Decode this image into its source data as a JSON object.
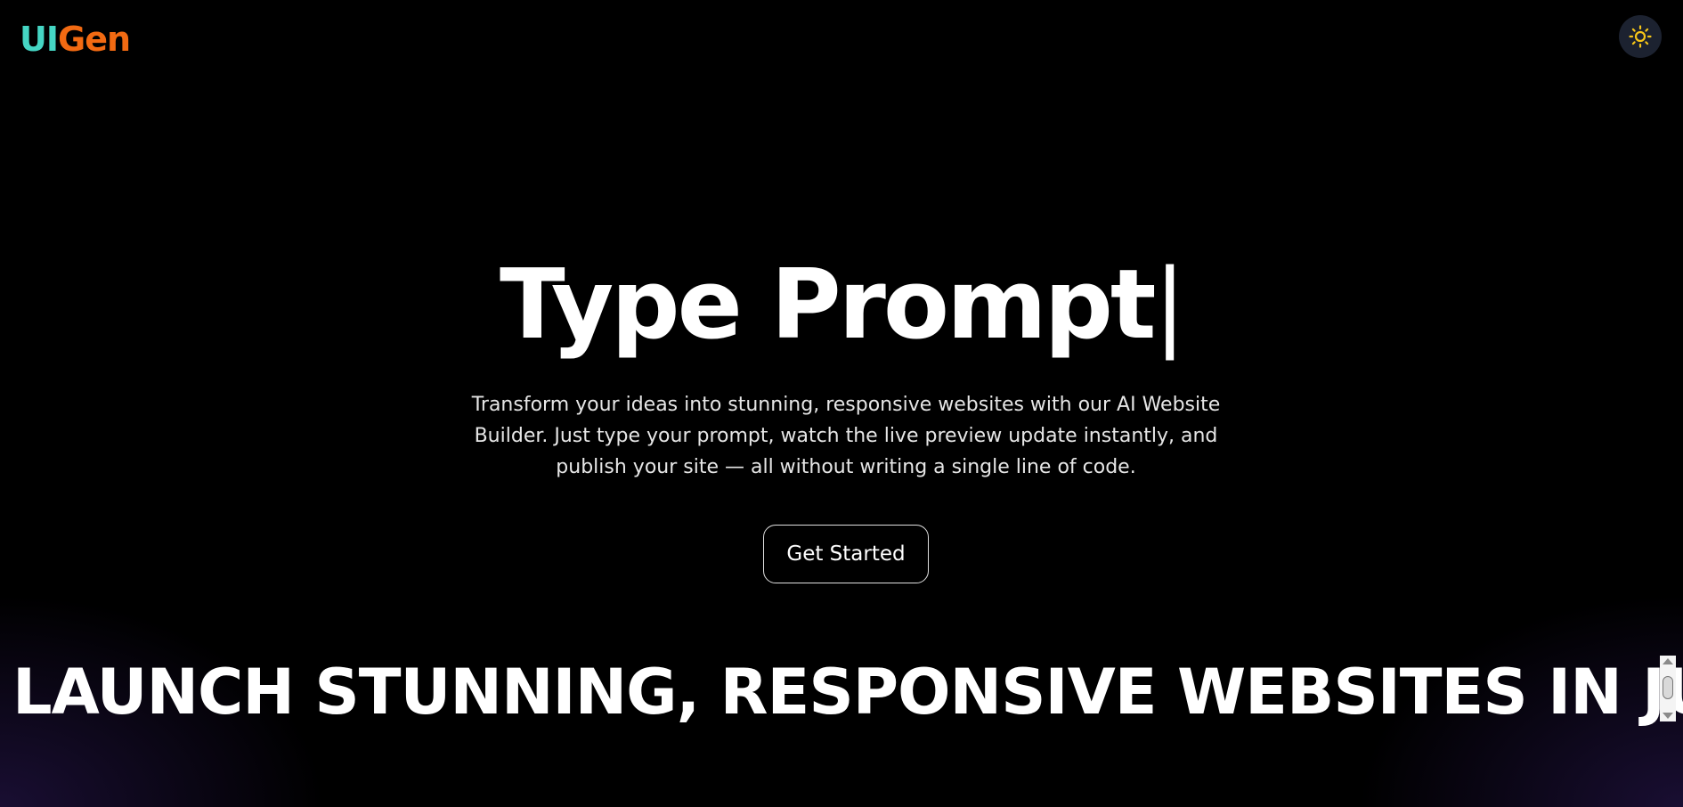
{
  "header": {
    "logo_part1": "UI",
    "logo_part2": "Gen",
    "logo_colors": {
      "part1": "#45d6c4",
      "part2": "#f26a12"
    },
    "theme_toggle_icon": "sun-icon",
    "theme_toggle_color": "#f5c518"
  },
  "hero": {
    "title": "Type Prompt",
    "cursor": "|",
    "description": "Transform your ideas into stunning, responsive websites with our AI Website Builder. Just type your prompt, watch the live preview update instantly, and publish your site — all without writing a single line of code.",
    "cta_label": "Get Started"
  },
  "marquee": {
    "text": "LAUNCH STUNNING, RESPONSIVE WEBSITES IN JUST"
  }
}
